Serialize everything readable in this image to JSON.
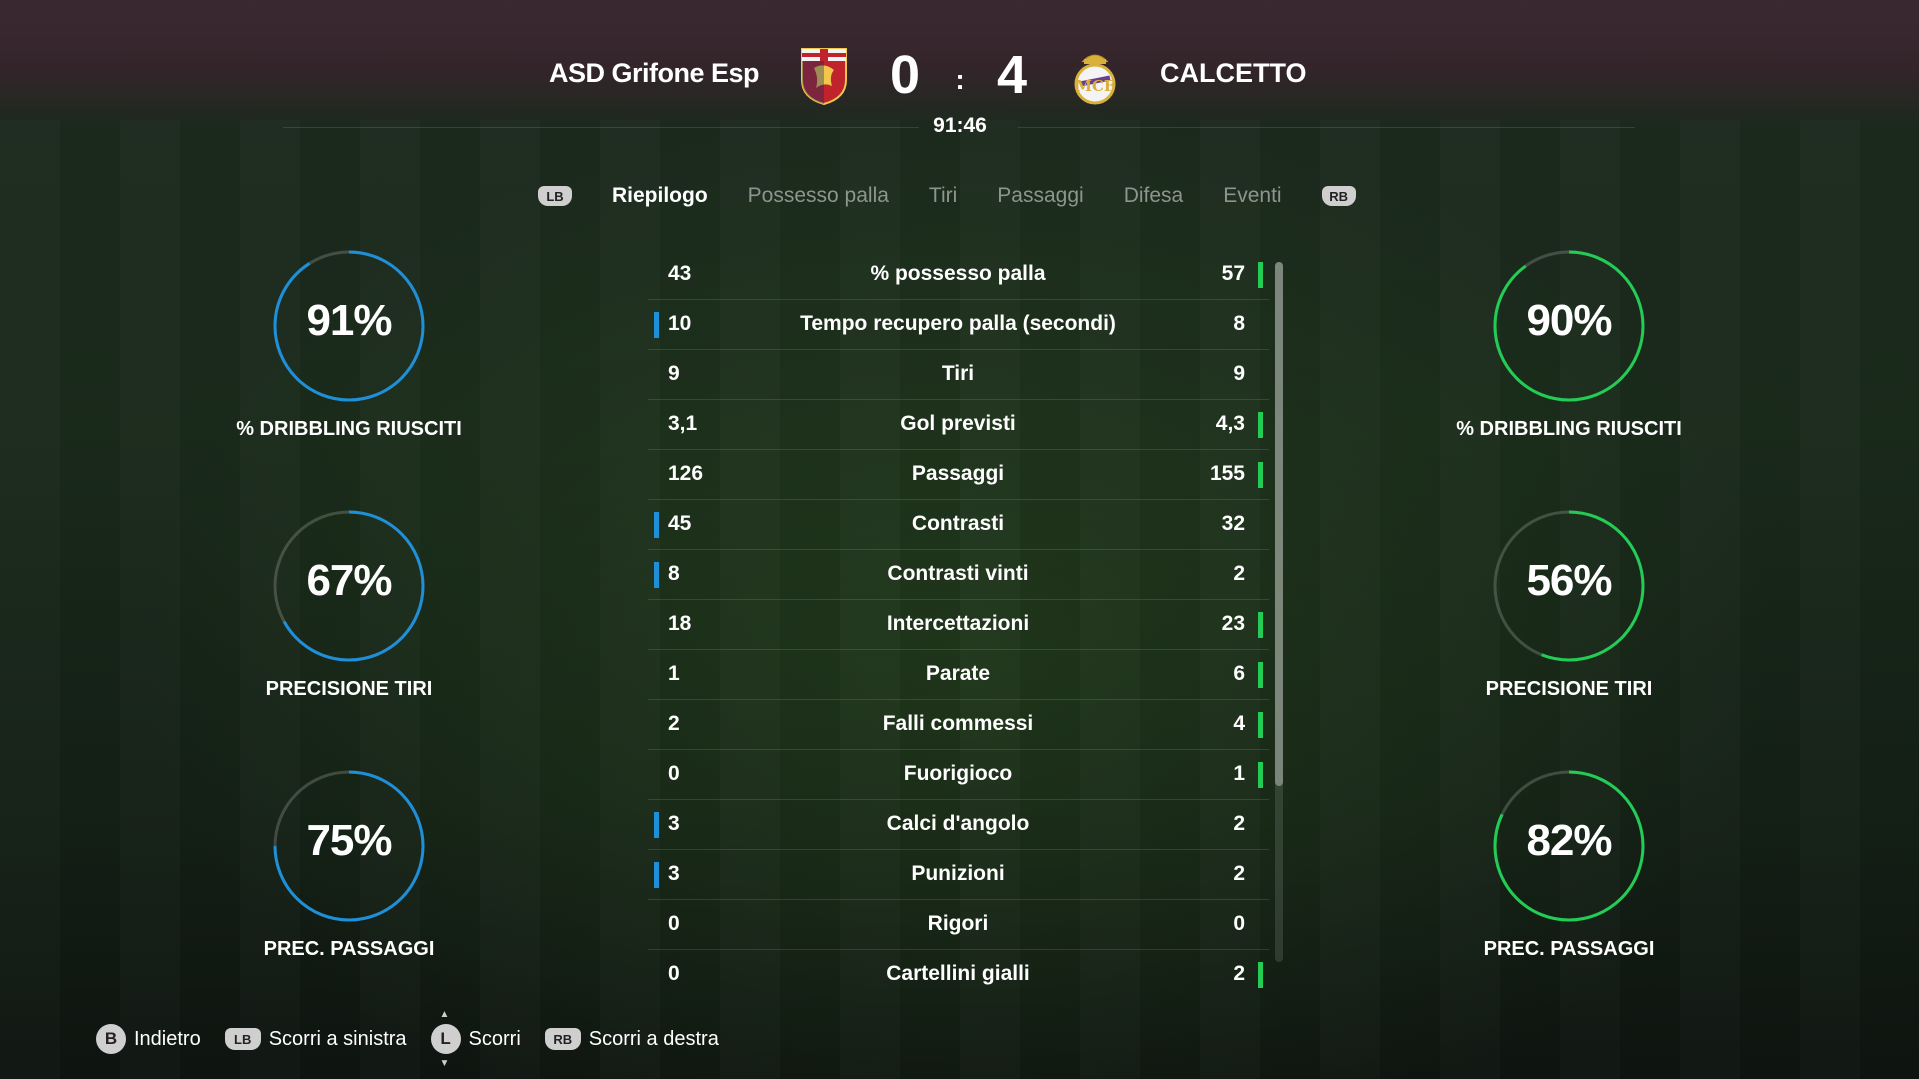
{
  "header": {
    "home_team": "ASD Grifone Esp",
    "away_team": "CALCETTO",
    "home_score": "0",
    "away_score": "4",
    "separator": ":",
    "clock": "91:46"
  },
  "tabs": {
    "left_button": "LB",
    "right_button": "RB",
    "items": [
      "Riepilogo",
      "Possesso palla",
      "Tiri",
      "Passaggi",
      "Difesa",
      "Eventi"
    ],
    "active": "Riepilogo"
  },
  "colors": {
    "home": "#1e8fd9",
    "away": "#22cc55"
  },
  "home_rings": [
    {
      "value": "91%",
      "fraction": 0.91,
      "label": "% DRIBBLING RIUSCITI"
    },
    {
      "value": "67%",
      "fraction": 0.67,
      "label": "PRECISIONE TIRI"
    },
    {
      "value": "75%",
      "fraction": 0.75,
      "label": "PREC. PASSAGGI"
    }
  ],
  "away_rings": [
    {
      "value": "90%",
      "fraction": 0.9,
      "label": "% DRIBBLING RIUSCITI"
    },
    {
      "value": "56%",
      "fraction": 0.56,
      "label": "PRECISIONE TIRI"
    },
    {
      "value": "82%",
      "fraction": 0.82,
      "label": "PREC. PASSAGGI"
    }
  ],
  "stats": [
    {
      "home": "43",
      "label": "% possesso palla",
      "away": "57",
      "leader": "away"
    },
    {
      "home": "10",
      "label": "Tempo recupero palla (secondi)",
      "away": "8",
      "leader": "home"
    },
    {
      "home": "9",
      "label": "Tiri",
      "away": "9",
      "leader": "none"
    },
    {
      "home": "3,1",
      "label": "Gol previsti",
      "away": "4,3",
      "leader": "away"
    },
    {
      "home": "126",
      "label": "Passaggi",
      "away": "155",
      "leader": "away"
    },
    {
      "home": "45",
      "label": "Contrasti",
      "away": "32",
      "leader": "home"
    },
    {
      "home": "8",
      "label": "Contrasti vinti",
      "away": "2",
      "leader": "home"
    },
    {
      "home": "18",
      "label": "Intercettazioni",
      "away": "23",
      "leader": "away"
    },
    {
      "home": "1",
      "label": "Parate",
      "away": "6",
      "leader": "away"
    },
    {
      "home": "2",
      "label": "Falli commessi",
      "away": "4",
      "leader": "away"
    },
    {
      "home": "0",
      "label": "Fuorigioco",
      "away": "1",
      "leader": "away"
    },
    {
      "home": "3",
      "label": "Calci d'angolo",
      "away": "2",
      "leader": "home"
    },
    {
      "home": "3",
      "label": "Punizioni",
      "away": "2",
      "leader": "home"
    },
    {
      "home": "0",
      "label": "Rigori",
      "away": "0",
      "leader": "none"
    },
    {
      "home": "0",
      "label": "Cartellini gialli",
      "away": "2",
      "leader": "away"
    }
  ],
  "footer": {
    "back_button": "B",
    "back_label": "Indietro",
    "scroll_left_button": "LB",
    "scroll_left_label": "Scorri a sinistra",
    "scroll_button": "L",
    "scroll_label": "Scorri",
    "scroll_right_button": "RB",
    "scroll_right_label": "Scorri a destra"
  }
}
